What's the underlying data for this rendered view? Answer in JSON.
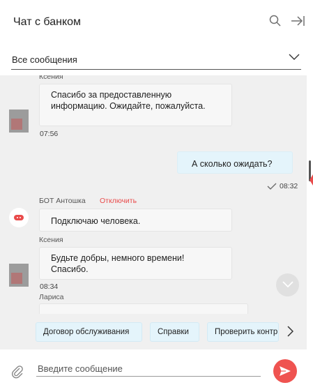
{
  "header": {
    "title": "Чат с банком",
    "icons": {
      "search": "search-icon",
      "close": "collapse-panel-icon"
    }
  },
  "filter": {
    "selected": "Все сообщения",
    "icon": "chevron-down-icon"
  },
  "messages": [
    {
      "sender": "Ксения",
      "text": "Спасибо за предоставленную информацию. Ожидайте, пожалуйста.",
      "time": "07:56",
      "direction": "incoming"
    },
    {
      "text": "А сколько ожидать?",
      "time": "08:32",
      "direction": "outgoing",
      "status_icon": "check-icon"
    },
    {
      "sender": "БОТ Антошка",
      "action": "Отключить",
      "text": "Подключаю человека.",
      "direction": "incoming"
    },
    {
      "sender": "Ксения",
      "text": "Будьте добры, немного времени! Спасибо.",
      "time": "08:34",
      "direction": "incoming"
    },
    {
      "sender": "Лариса",
      "text": "",
      "direction": "incoming"
    }
  ],
  "quick_replies": [
    "Договор обслуживания",
    "Справки",
    "Проверить контр"
  ],
  "composer": {
    "placeholder": "Введите сообщение"
  },
  "colors": {
    "accent": "#ef5350",
    "outgoing_bubble": "#e4f4fb",
    "chat_bg": "#f0f0f0"
  }
}
